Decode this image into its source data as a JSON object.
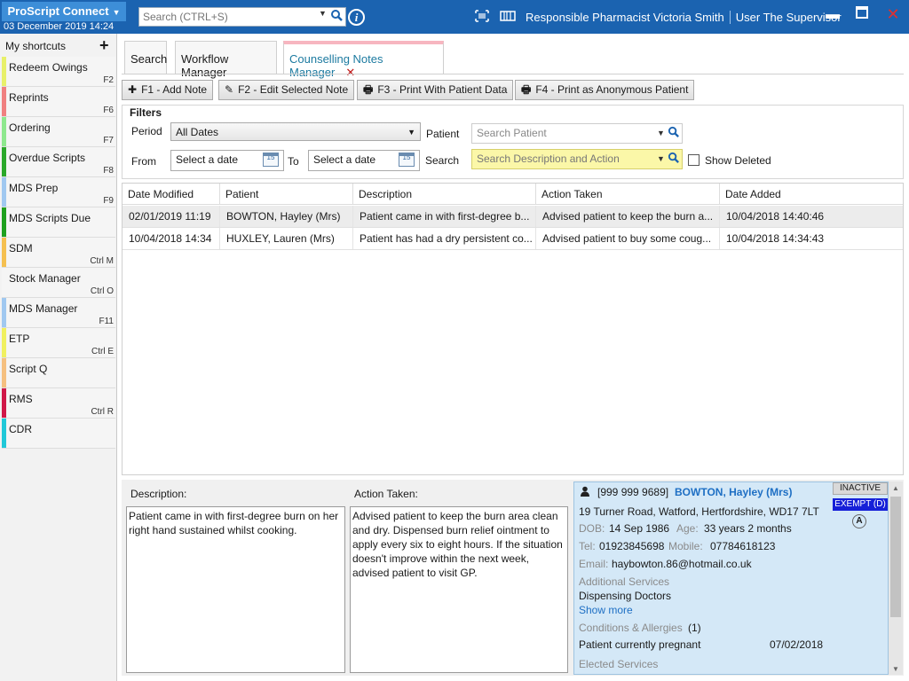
{
  "app": {
    "brand": "ProScript Connect",
    "date": "03 December 2019 14:24"
  },
  "search": {
    "placeholder": "Search (CTRL+S)"
  },
  "topbar": {
    "pharmacist": "Responsible Pharmacist Victoria Smith",
    "user": "User The Supervisor"
  },
  "sidebar": {
    "title": "My shortcuts",
    "items": [
      {
        "label": "Redeem Owings",
        "key": "F2",
        "color": "#e8f06a"
      },
      {
        "label": "Reprints",
        "key": "F6",
        "color": "#f08080"
      },
      {
        "label": "Ordering",
        "key": "F7",
        "color": "#8ee88e"
      },
      {
        "label": "Overdue Scripts",
        "key": "F8",
        "color": "#2aa82a"
      },
      {
        "label": "MDS Prep",
        "key": "F9",
        "color": "#a0c8f0"
      },
      {
        "label": "MDS Scripts Due",
        "key": "",
        "color": "#1ea01e"
      },
      {
        "label": "SDM",
        "key": "Ctrl M",
        "color": "#f5c050"
      },
      {
        "label": "Stock Manager",
        "key": "Ctrl O",
        "color": "#f5f5f5"
      },
      {
        "label": "MDS Manager",
        "key": "F11",
        "color": "#a0c8f0"
      },
      {
        "label": "ETP",
        "key": "Ctrl E",
        "color": "#f0f060"
      },
      {
        "label": "Script Q",
        "key": "",
        "color": "#f5c080"
      },
      {
        "label": "RMS",
        "key": "Ctrl R",
        "color": "#d01848"
      },
      {
        "label": "CDR",
        "key": "",
        "color": "#20c8d8"
      }
    ]
  },
  "tabs": {
    "search": "Search",
    "workflow": "Workflow Manager",
    "counselling": "Counselling Notes Manager"
  },
  "toolbar": {
    "add": "F1 - Add Note",
    "edit": "F2 - Edit Selected Note",
    "print_data": "F3 - Print With Patient Data",
    "print_anon": "F4 - Print as Anonymous Patient"
  },
  "filters": {
    "title": "Filters",
    "period_label": "Period",
    "period_value": "All Dates",
    "patient_label": "Patient",
    "patient_placeholder": "Search Patient",
    "from_label": "From",
    "to_label": "To",
    "date_placeholder": "Select a date",
    "search_label": "Search",
    "search_placeholder": "Search Description and Action",
    "show_deleted": "Show Deleted",
    "calendar_day": "15"
  },
  "table": {
    "headers": [
      "Date Modified",
      "Patient",
      "Description",
      "Action Taken",
      "Date Added"
    ],
    "rows": [
      [
        "02/01/2019 11:19",
        "BOWTON, Hayley (Mrs)",
        "Patient came in with first-degree b...",
        "Advised patient to keep the burn a...",
        "10/04/2018 14:40:46"
      ],
      [
        "10/04/2018 14:34",
        "HUXLEY, Lauren (Mrs)",
        "Patient has had a dry persistent co...",
        "Advised patient to buy some coug...",
        "10/04/2018 14:34:43"
      ]
    ]
  },
  "detail": {
    "description_label": "Description:",
    "description": "Patient came in with first-degree burn on her right hand sustained whilst cooking.",
    "action_label": "Action Taken:",
    "action": "Advised patient to keep the burn area clean and dry. Dispensed burn relief ointment to apply every six to eight hours. If the situation doesn't improve within the next week, advised patient to visit GP."
  },
  "patient": {
    "nhs": "[999 999 9689]",
    "name": "BOWTON, Hayley (Mrs)",
    "address": "19 Turner Road, Watford, Hertfordshire, WD17 7LT",
    "dob_label": "DOB:",
    "dob": "14 Sep 1986",
    "age_label": "Age:",
    "age": "33 years 2 months",
    "tel_label": "Tel:",
    "tel": "01923845698",
    "mobile_label": "Mobile:",
    "mobile": "07784618123",
    "email_label": "Email:",
    "email": "haybowton.86@hotmail.co.uk",
    "additional_label": "Additional Services",
    "additional_value": "Dispensing Doctors",
    "show_more": "Show more",
    "conditions_label": "Conditions & Allergies",
    "conditions_count": "(1)",
    "condition": "Patient currently pregnant",
    "condition_date": "07/02/2018",
    "elected_label": "Elected Services",
    "status": "INACTIVE",
    "exempt": "EXEMPT (D)",
    "badge": "A"
  }
}
